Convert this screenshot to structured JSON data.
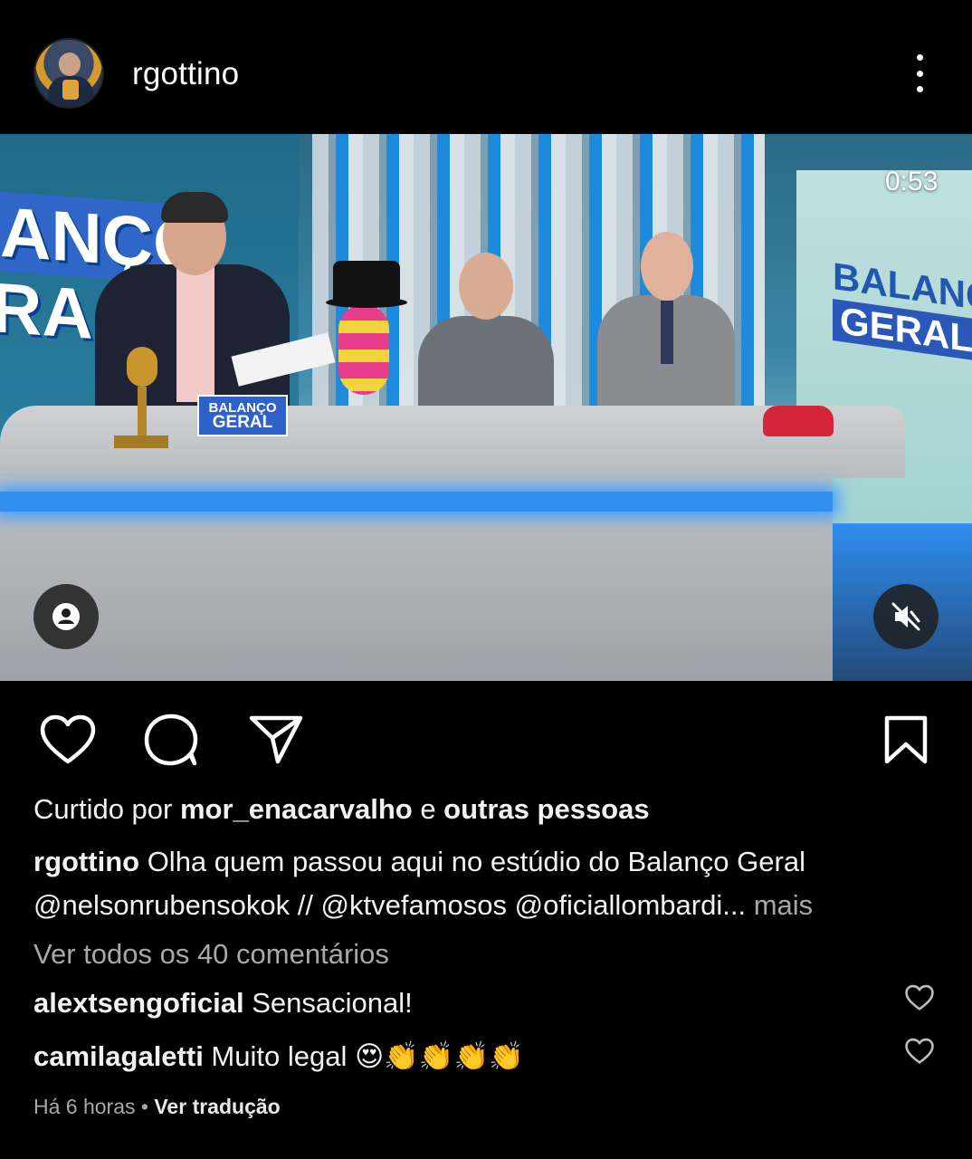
{
  "header": {
    "username": "rgottino",
    "avatar_icon": "profile-avatar",
    "menu_icon": "more-vertical-icon"
  },
  "media": {
    "timer": "0:53",
    "tag_icon": "person-tag-icon",
    "mute_icon": "muted-speaker-icon",
    "desk_sign_top": "BALANÇO",
    "desk_sign_bottom": "GERAL",
    "logo_left_top": "ANÇO",
    "logo_left_bottom": "RA",
    "logo_right_top": "BALANÇO",
    "logo_right_bottom": "GERAL"
  },
  "actions": {
    "like_icon": "heart-icon",
    "comment_icon": "comment-icon",
    "share_icon": "send-icon",
    "save_icon": "bookmark-icon"
  },
  "likes": {
    "prefix": "Curtido por ",
    "user": "mor_enacarvalho",
    "connector": " e ",
    "others": "outras pessoas"
  },
  "caption": {
    "user": "rgottino",
    "text": " Olha quem passou aqui no estúdio do Balanço Geral @nelsonrubensokok // @ktvefamosos @oficiallombardi...",
    "more": " mais"
  },
  "view_all": "Ver todos os 40 comentários",
  "comments": [
    {
      "user": "alextsengoficial",
      "text": " Sensacional!"
    },
    {
      "user": "camilagaletti",
      "text": " Muito legal 😍👏👏👏👏"
    }
  ],
  "meta": {
    "time": "Há 6 horas",
    "separator": " • ",
    "translate": "Ver tradução"
  },
  "colors": {
    "background": "#000000",
    "text": "#f5f5f5",
    "muted": "#a8a8a8"
  }
}
